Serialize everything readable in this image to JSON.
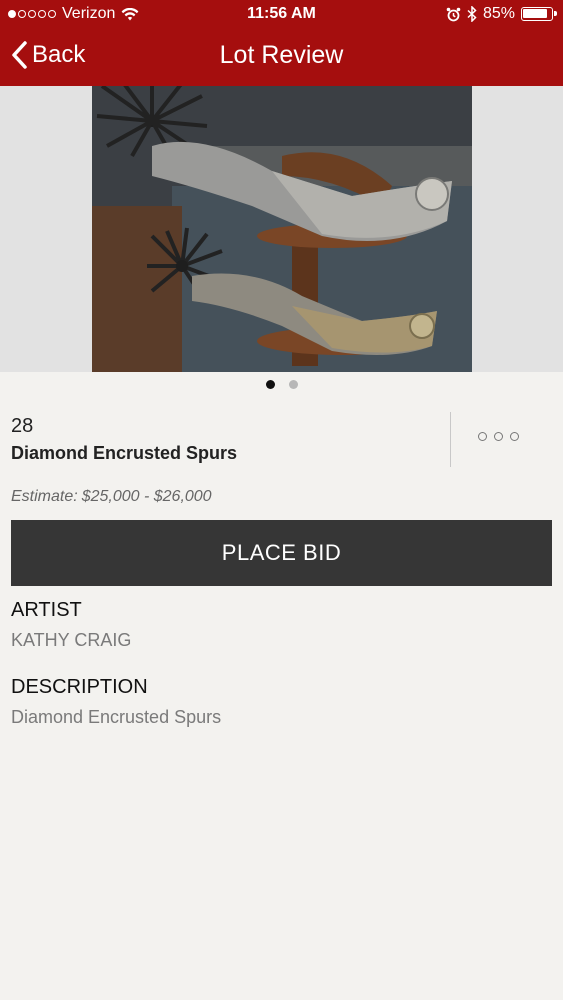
{
  "status_bar": {
    "carrier": "Verizon",
    "time": "11:56 AM",
    "battery": "85%",
    "icons": [
      "wifi-icon",
      "alarm-icon",
      "bluetooth-icon",
      "battery-icon"
    ]
  },
  "nav": {
    "back_label": "Back",
    "title": "Lot Review"
  },
  "gallery": {
    "image_subject": "silver spurs on wooden stand",
    "page_count": 2,
    "active_page": 1
  },
  "lot": {
    "number": "28",
    "title": "Diamond Encrusted Spurs",
    "estimate_label": "Estimate:",
    "estimate_value": "$25,000 - $26,000"
  },
  "actions": {
    "place_bid_label": "PLACE BID"
  },
  "details": {
    "artist_heading": "ARTIST",
    "artist_value": "KATHY CRAIG",
    "description_heading": "DESCRIPTION",
    "description_value": "Diamond Encrusted Spurs"
  },
  "colors": {
    "header": "#a50e0e",
    "button": "#363636",
    "background": "#f3f2ef"
  }
}
